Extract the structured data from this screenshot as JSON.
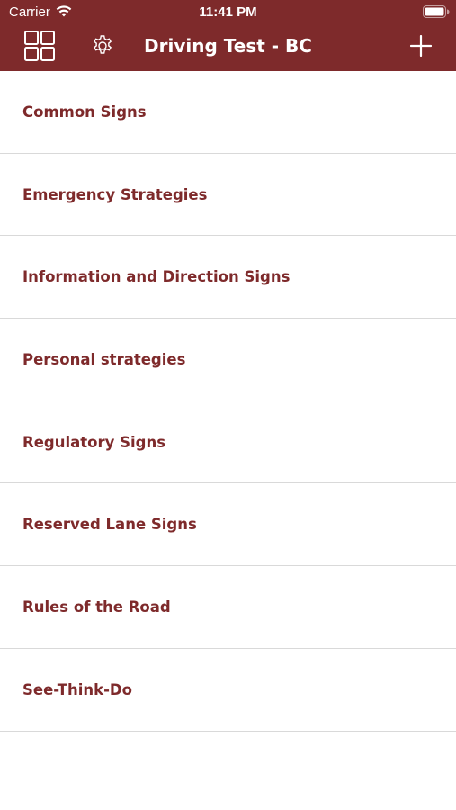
{
  "status_bar": {
    "carrier": "Carrier",
    "time": "11:41 PM"
  },
  "navbar": {
    "title": "Driving Test - BC",
    "left_icons": [
      "grid-icon",
      "gear-icon"
    ],
    "right_icon": "plus-icon"
  },
  "categories": [
    {
      "label": "Common Signs"
    },
    {
      "label": "Emergency Strategies"
    },
    {
      "label": "Information and Direction Signs"
    },
    {
      "label": "Personal strategies"
    },
    {
      "label": "Regulatory Signs"
    },
    {
      "label": "Reserved Lane Signs"
    },
    {
      "label": "Rules of the Road"
    },
    {
      "label": "See-Think-Do"
    }
  ],
  "colors": {
    "brand": "#7e2a2b",
    "background": "#ffffff",
    "separator": "#d9d9d9"
  }
}
